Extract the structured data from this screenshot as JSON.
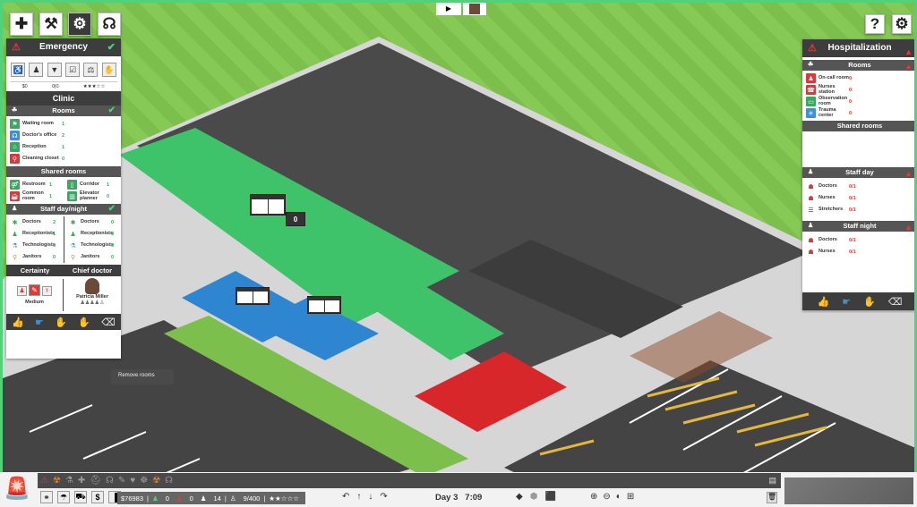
{
  "top_toolbar": [
    {
      "name": "hospital-cross-icon",
      "glyph": "✚"
    },
    {
      "name": "build-hammer-icon",
      "glyph": "⚒"
    },
    {
      "name": "gears-icon",
      "glyph": "⚙"
    },
    {
      "name": "stethoscope-icon",
      "glyph": "☊"
    }
  ],
  "top_right": {
    "help": "?",
    "settings": "⚙"
  },
  "camera_tabs": [
    "▶",
    ""
  ],
  "left_panel": {
    "title": "Emergency",
    "tool_icons": [
      "waiting",
      "receptionist",
      "scrubs",
      "checkbox",
      "scale",
      "hand"
    ],
    "summary": {
      "money": "$0",
      "patients": "0|0",
      "stars": "★★★☆☆"
    },
    "clinic_title": "Clinic",
    "rooms_title": "Rooms",
    "rooms": [
      {
        "label": "Waiting room",
        "value": "1",
        "color": "#3aa860",
        "glyph": "⚑"
      },
      {
        "label": "Doctor's office",
        "value": "2",
        "color": "#3e8fd6",
        "glyph": "☊"
      },
      {
        "label": "Reception",
        "value": "1",
        "color": "#3aa860",
        "glyph": "⌂"
      },
      {
        "label": "Cleaning closet",
        "value": "0",
        "color": "#d63a3a",
        "glyph": "⚲"
      }
    ],
    "shared_title": "Shared rooms",
    "shared_rooms": [
      {
        "label": "Restroom",
        "value": "1",
        "color": "#3aa860",
        "glyph": "⚤"
      },
      {
        "label": "Corridor",
        "value": "1",
        "color": "#3aa860",
        "glyph": "▯"
      },
      {
        "label": "Common room",
        "value": "1",
        "color": "#d63a3a",
        "glyph": "☕"
      },
      {
        "label": "Elevator planner",
        "value": "0",
        "color": "#3aa860",
        "glyph": "▥"
      }
    ],
    "staff_title": "Staff day/night",
    "staff_day": [
      {
        "label": "Doctors",
        "value": "2",
        "glyph": "✱",
        "gcolor": "#2eae4f"
      },
      {
        "label": "Receptionists",
        "value": "1",
        "glyph": "♟",
        "gcolor": "#2eae4f"
      },
      {
        "label": "Technologists",
        "value": "0",
        "glyph": "⚗",
        "gcolor": "#3e8fd6"
      },
      {
        "label": "Janitors",
        "value": "0",
        "glyph": "⚲",
        "gcolor": "#d68a3a"
      }
    ],
    "staff_night": [
      {
        "label": "Doctors",
        "value": "0",
        "glyph": "✱",
        "gcolor": "#2eae4f"
      },
      {
        "label": "Receptionists",
        "value": "0",
        "glyph": "♟",
        "gcolor": "#2eae4f"
      },
      {
        "label": "Technologists",
        "value": "0",
        "glyph": "⚗",
        "gcolor": "#3e8fd6"
      },
      {
        "label": "Janitors",
        "value": "0",
        "glyph": "⚲",
        "gcolor": "#d68a3a"
      }
    ],
    "certainty_title": "Certainty",
    "certainty_value": "Medium",
    "chief_title": "Chief doctor",
    "chief_name": "Patricia Miller",
    "chief_rating": "♟♟♟♟♙",
    "actions": [
      "👍",
      "☛",
      "✋",
      "✋",
      "⌫"
    ]
  },
  "tooltip": "Remove rooms",
  "right_panel": {
    "title": "Hospitalization",
    "rooms_title": "Rooms",
    "rooms": [
      {
        "label": "On-call room",
        "value": "0",
        "color": "#d63a3a",
        "glyph": "♟"
      },
      {
        "label": "Nurses station",
        "value": "0",
        "color": "#d63a3a",
        "glyph": "☎"
      },
      {
        "label": "Observation room",
        "value": "0",
        "color": "#3aa860",
        "glyph": "▭"
      },
      {
        "label": "Trauma center",
        "value": "0",
        "color": "#3e8fd6",
        "glyph": "✳"
      }
    ],
    "shared_title": "Shared rooms",
    "staff_day_title": "Staff day",
    "staff_day": [
      {
        "label": "Doctors",
        "value": "0/1",
        "glyph": "☗"
      },
      {
        "label": "Nurses",
        "value": "0/1",
        "glyph": "☗"
      },
      {
        "label": "Stretchers",
        "value": "0/1",
        "glyph": "☰"
      }
    ],
    "staff_night_title": "Staff night",
    "staff_night": [
      {
        "label": "Doctors",
        "value": "0/1",
        "glyph": "☗"
      },
      {
        "label": "Nurses",
        "value": "0/1",
        "glyph": "☗"
      }
    ],
    "actions": [
      "👍",
      "☛",
      "✋",
      "⌫"
    ]
  },
  "map_signs": {
    "reception_queue": "0"
  },
  "bottom_bar": {
    "department_icons": [
      "🚨",
      "☢",
      "⚗",
      "✚",
      "⛑",
      "☊",
      "✎",
      "♥",
      "☸",
      "☢",
      "☊"
    ],
    "tool_buttons": [
      "⚭",
      "☂",
      "⛟",
      "$",
      "▐"
    ],
    "money": "$76983",
    "patients_green": "0",
    "patients_red": "0",
    "patients_walk": "14",
    "capacity": "9/400",
    "rating": "★★☆☆☆",
    "nav_arrows": [
      "↶",
      "↑",
      "↓",
      "↷"
    ],
    "day": "Day 3",
    "time": "7:09",
    "view_icons": [
      "◆",
      "⬢",
      "⬛"
    ],
    "zoom_icons": [
      "⊕",
      "⊖",
      "◐",
      "⊞"
    ]
  }
}
